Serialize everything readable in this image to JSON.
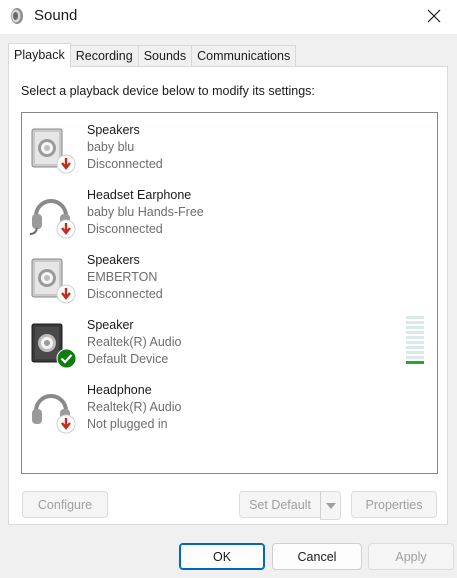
{
  "window": {
    "title": "Sound",
    "close_icon": "close-icon"
  },
  "tabs": [
    {
      "label": "Playback",
      "active": true
    },
    {
      "label": "Recording",
      "active": false
    },
    {
      "label": "Sounds",
      "active": false
    },
    {
      "label": "Communications",
      "active": false
    }
  ],
  "instruction": "Select a playback device below to modify its settings:",
  "devices": [
    {
      "name": "Speakers",
      "sub": "baby blu",
      "status": "Disconnected",
      "icon": "speaker-icon",
      "badge": "disconnected-badge"
    },
    {
      "name": "Headset Earphone",
      "sub": "baby blu Hands-Free",
      "status": "Disconnected",
      "icon": "headset-icon",
      "badge": "disconnected-badge"
    },
    {
      "name": "Speakers",
      "sub": "EMBERTON",
      "status": "Disconnected",
      "icon": "speaker-icon",
      "badge": "disconnected-badge"
    },
    {
      "name": "Speaker",
      "sub": "Realtek(R) Audio",
      "status": "Default Device",
      "icon": "speaker-icon",
      "badge": "default-check-badge"
    },
    {
      "name": "Headphone",
      "sub": "Realtek(R) Audio",
      "status": "Not plugged in",
      "icon": "headphone-icon",
      "badge": "unplugged-badge"
    }
  ],
  "volume_meter": {
    "level": 0.1
  },
  "buttons": {
    "configure": "Configure",
    "set_default": "Set Default",
    "properties": "Properties",
    "ok": "OK",
    "cancel": "Cancel",
    "apply": "Apply"
  },
  "colors": {
    "accent": "#0067c0",
    "badge_red": "#c42b1c",
    "badge_green": "#107c10",
    "meter_on": "#2ea12e",
    "meter_off": "#d9ebe9"
  }
}
